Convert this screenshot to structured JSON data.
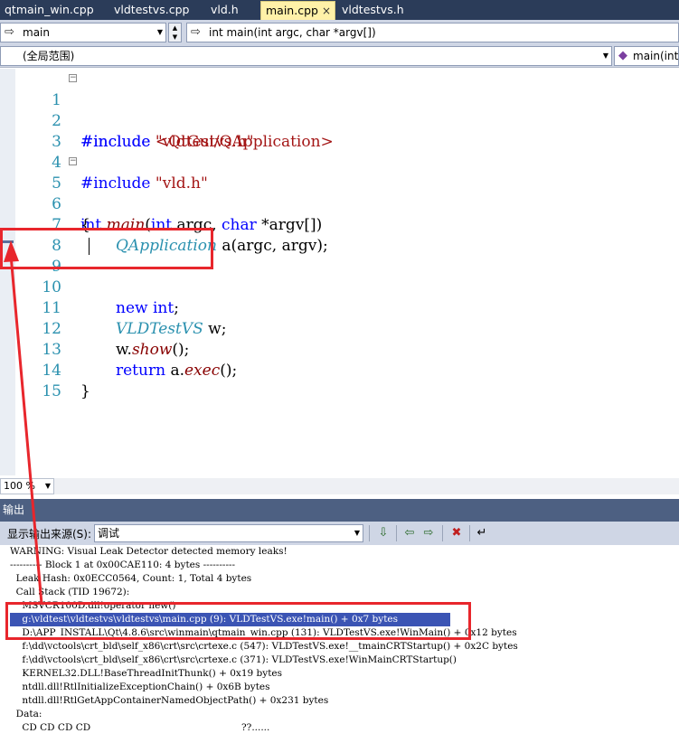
{
  "tabs": [
    {
      "label": "qtmain_win.cpp"
    },
    {
      "label": "vldtestvs.cpp"
    },
    {
      "label": "vld.h"
    },
    {
      "label": "main.cpp",
      "close": "×"
    },
    {
      "label": "vldtestvs.h"
    }
  ],
  "nav": {
    "scope_combo": "main",
    "member_combo": "int main(int argc, char *argv[])",
    "global_scope": "(全局范围)",
    "right_combo": "main(int"
  },
  "editor": {
    "line_numbers": [
      "1",
      "2",
      "3",
      "4",
      "5",
      "6",
      "7",
      "8",
      "9",
      "10",
      "11",
      "12",
      "13",
      "14",
      "15"
    ],
    "code": {
      "l1_kw": "#include ",
      "l1_str": "\"vldtestvs.h\"",
      "l2_kw": "#include ",
      "l2_str": "<QtGui/QApplication>",
      "l4_kw": "#include ",
      "l4_str": "\"vld.h\"",
      "l5_kw1": "int ",
      "l5_fn": "main",
      "l5_p1": "(",
      "l5_kw2": "int ",
      "l5_p2": "argc, ",
      "l5_kw3": "char ",
      "l5_p3": "*argv[])",
      "l6": "{",
      "l7_ty": "QApplication",
      "l7_rest": " a(argc, argv);",
      "l9_kw1": "new ",
      "l9_kw2": "int",
      "l9_rest": ";",
      "l11_ty": "VLDTestVS",
      "l11_rest": " w;",
      "l12_a": "w.",
      "l12_fn": "show",
      "l12_b": "();",
      "l13_kw": "return ",
      "l13_a": "a.",
      "l13_fn": "exec",
      "l13_b": "();",
      "l14": "}"
    },
    "zoom": "100 %"
  },
  "output": {
    "title": "输出",
    "source_label": "显示输出来源(S):",
    "source_value": "调试",
    "lines": [
      "WARNING: Visual Leak Detector detected memory leaks!",
      "---------- Block 1 at 0x00CAE110: 4 bytes ----------",
      "  Leak Hash: 0x0ECC0564, Count: 1, Total 4 bytes",
      "  Call Stack (TID 19672):",
      "    MSVCR100D.dll!operator new()",
      "    g:\\vldtest\\vldtestvs\\vldtestvs\\main.cpp (9): VLDTestVS.exe!main() + 0x7 bytes",
      "    D:\\APP_INSTALL\\Qt\\4.8.6\\src\\winmain\\qtmain_win.cpp (131): VLDTestVS.exe!WinMain() + 0x12 bytes",
      "    f:\\dd\\vctools\\crt_bld\\self_x86\\crt\\src\\crtexe.c (547): VLDTestVS.exe!__tmainCRTStartup() + 0x2C bytes",
      "    f:\\dd\\vctools\\crt_bld\\self_x86\\crt\\src\\crtexe.c (371): VLDTestVS.exe!WinMainCRTStartup()",
      "    KERNEL32.DLL!BaseThreadInitThunk() + 0x19 bytes",
      "    ntdll.dll!RtlInitializeExceptionChain() + 0x6B bytes",
      "    ntdll.dll!RtlGetAppContainerNamedObjectPath() + 0x231 bytes",
      "  Data:",
      "    CD CD CD CD                                                  ??......"
    ]
  },
  "colors": {
    "annotation": "#e8262c",
    "keyword": "#0000ff",
    "string": "#a31515",
    "type": "#2b91af",
    "selection": "#3b54b4"
  }
}
